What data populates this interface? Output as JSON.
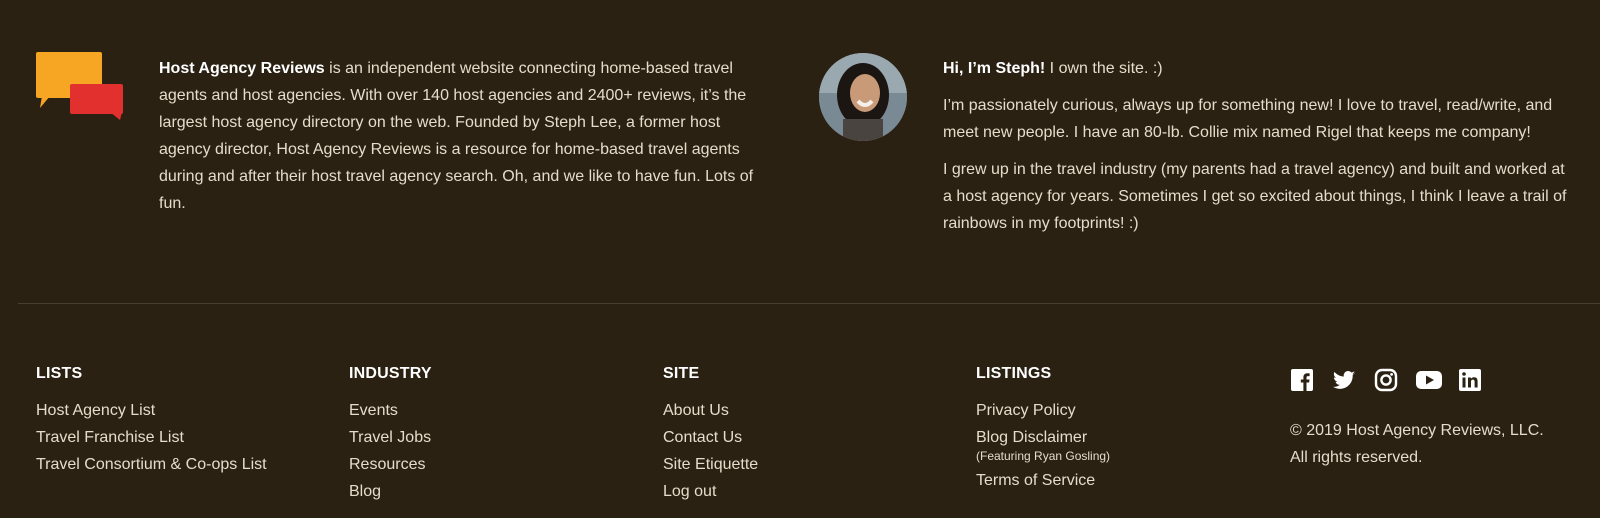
{
  "about": {
    "brand": "Host Agency Reviews",
    "text": " is an independent website connecting home-based travel agents and host agencies. With over 140 host agencies and 2400+ reviews, it’s the largest host agency directory on the web. Founded by Steph Lee, a former host agency director, Host Agency Reviews is a resource for home-based travel agents during and after their host travel agency search. Oh, and we like to have fun. Lots of fun."
  },
  "bio": {
    "greeting": "Hi, I’m Steph!",
    "greeting_rest": " I own the site. :)",
    "para1": "I’m passionately curious, always up for something new! I love to travel, read/write, and meet new people. I have an 80-lb. Collie mix named Rigel that keeps me company!",
    "para2": "I grew up in the travel industry (my parents had a travel agency) and built and worked at a host agency for years. Sometimes I get so excited about things, I think I leave a trail of rainbows in my footprints! :)"
  },
  "footer": {
    "lists": {
      "title": "LISTS",
      "links": [
        "Host Agency List",
        "Travel Franchise List",
        "Travel Consortium & Co-ops List"
      ]
    },
    "industry": {
      "title": "INDUSTRY",
      "links": [
        "Events",
        "Travel Jobs",
        "Resources",
        "Blog"
      ]
    },
    "site": {
      "title": "SITE",
      "links": [
        "About Us",
        "Contact Us",
        "Site Etiquette",
        "Log out"
      ]
    },
    "listings": {
      "title": "LISTINGS",
      "privacy": "Privacy Policy",
      "disclaimer": "Blog Disclaimer",
      "disclaimer_note": "(Featuring Ryan Gosling)",
      "terms": "Terms of Service"
    },
    "social_icons": [
      "facebook-icon",
      "twitter-icon",
      "instagram-icon",
      "youtube-icon",
      "linkedin-icon"
    ],
    "copyright": "© 2019 Host Agency Reviews, LLC.",
    "rights": "All rights reserved."
  },
  "colors": {
    "background": "#2b2113",
    "bubble_orange": "#f6a623",
    "bubble_red": "#e2302f",
    "text": "#e6dccb"
  }
}
